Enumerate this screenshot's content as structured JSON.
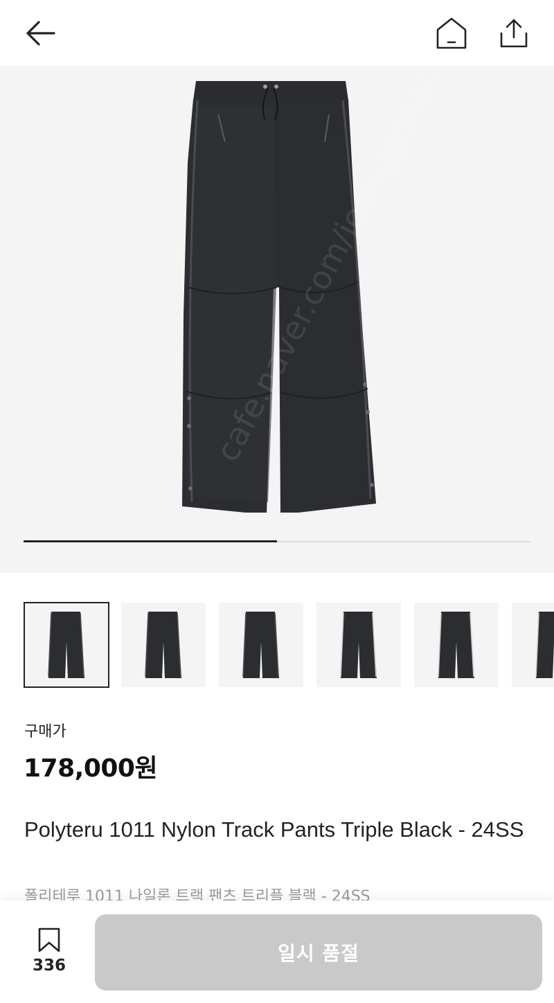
{
  "header": {
    "back_icon": "arrow-left-icon",
    "home_icon": "home-icon",
    "share_icon": "share-icon"
  },
  "gallery": {
    "watermark": "cafe.naver.com/joonggonara",
    "progress": 0.5,
    "thumbnail_count": 6,
    "active_thumbnail": 0
  },
  "product": {
    "price_caption": "구매가",
    "price": "178,000원",
    "title_en": "Polyteru 1011 Nylon Track Pants Triple Black - 24SS",
    "title_ko": "폴리테루 1011 나일론 트랙 팬츠 트리플 블랙 - 24SS"
  },
  "bottom_bar": {
    "bookmark_icon": "bookmark-icon",
    "bookmark_count": "336",
    "soldout_label": "일시 품절"
  },
  "colors": {
    "text": "#222222",
    "price": "#111111",
    "subtitle": "#9a9a9a",
    "disabled_button": "#c9c9c9",
    "image_bg": "#f4f4f4"
  }
}
